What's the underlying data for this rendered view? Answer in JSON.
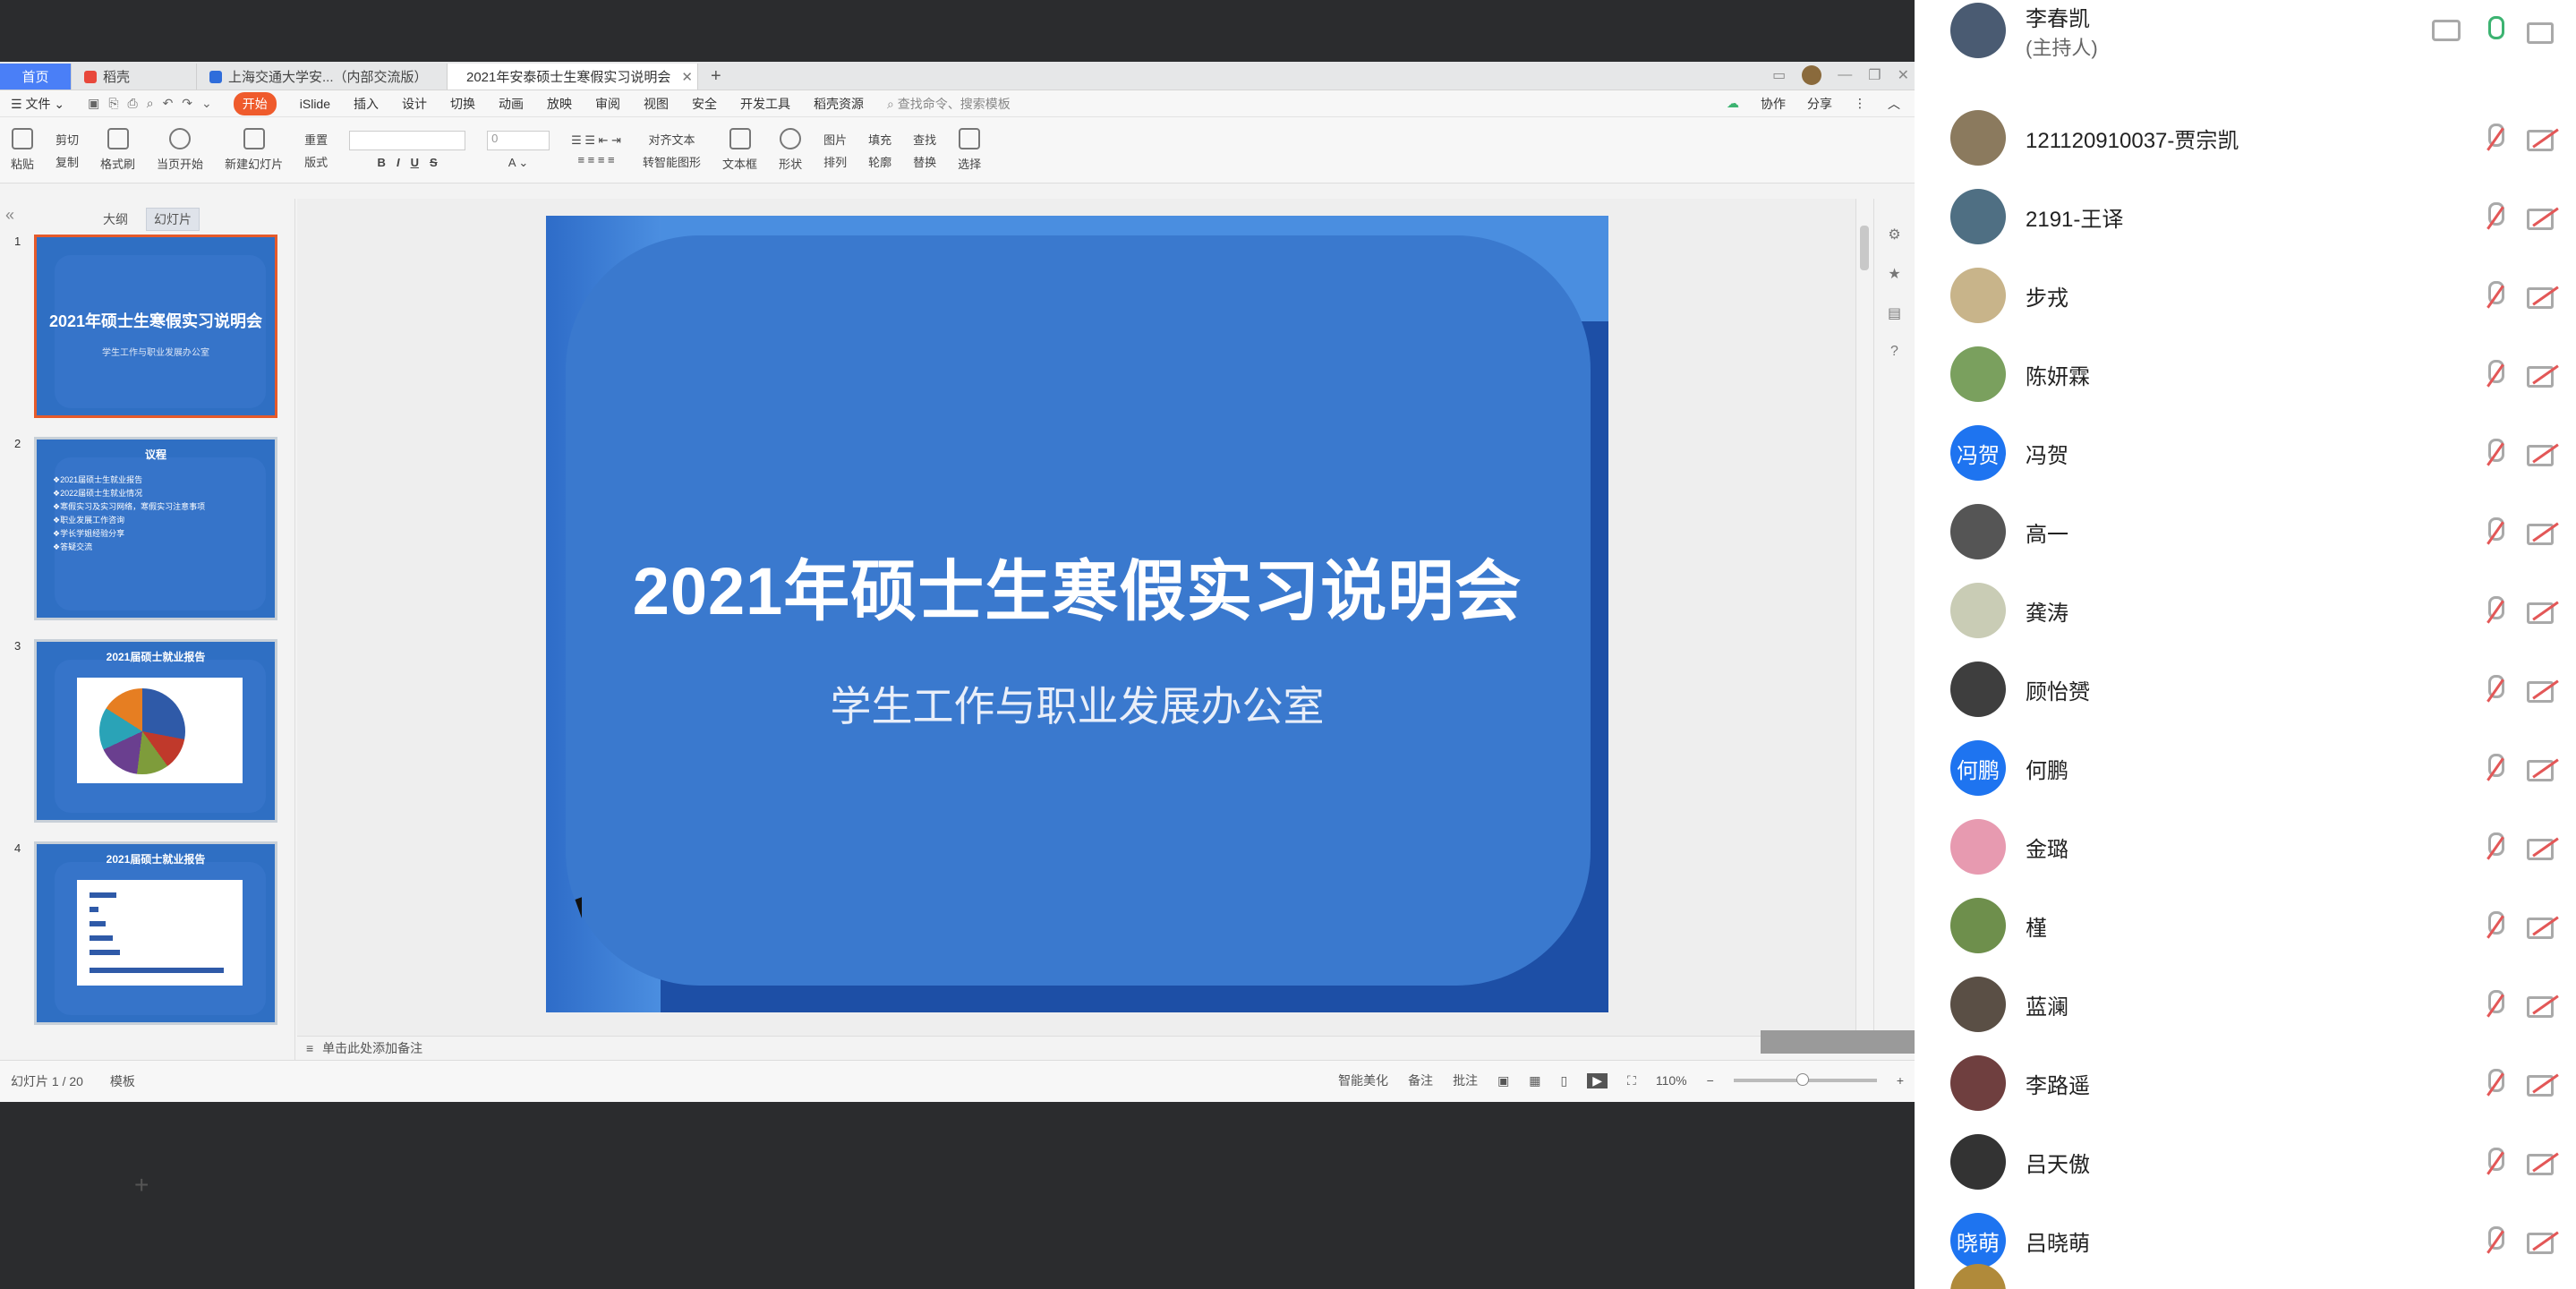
{
  "wps": {
    "tabs": [
      {
        "label": "首页"
      },
      {
        "label": "稻壳"
      },
      {
        "label": "上海交通大学安...（内部交流版）"
      },
      {
        "label": "2021年安泰硕士生寒假实习说明会"
      }
    ],
    "menu": [
      "文件",
      "开始",
      "iSlide",
      "插入",
      "设计",
      "切换",
      "动画",
      "放映",
      "审阅",
      "视图",
      "安全",
      "开发工具",
      "稻壳资源"
    ],
    "search_placeholder": "查找命令、搜索模板",
    "collab": "协作",
    "share": "分享",
    "ribbon": {
      "paste": "粘贴",
      "cut": "剪切",
      "copy": "复制",
      "format_painter": "格式刷",
      "from_current": "当页开始",
      "new_slide": "新建幻灯片",
      "layout": "版式",
      "reset": "重置",
      "font_size": "0",
      "align_text": "对齐文本",
      "smart_shape": "转智能图形",
      "textbox": "文本框",
      "shape": "形状",
      "picture": "图片",
      "arrange": "排列",
      "fill": "填充",
      "outline": "轮廓",
      "find": "查找",
      "replace": "替换",
      "select": "选择"
    },
    "left_tabs": {
      "outline": "大纲",
      "slides": "幻灯片"
    },
    "thumbs": [
      {
        "num": "1",
        "title": "2021年硕士生寒假实习说明会",
        "sub": "学生工作与职业发展办公室"
      },
      {
        "num": "2",
        "title": "议程",
        "items": [
          "2021届硕士生就业报告",
          "2022届硕士生就业情况",
          "寒假实习及实习网络，寒假实习注意事项",
          "职业发展工作咨询",
          "学长学姐经验分享",
          "答疑交流"
        ]
      },
      {
        "num": "3",
        "title": "2021届硕士就业报告"
      },
      {
        "num": "4",
        "title": "2021届硕士就业报告"
      }
    ],
    "slide": {
      "title": "2021年硕士生寒假实习说明会",
      "subtitle": "学生工作与职业发展办公室"
    },
    "notes_placeholder": "单击此处添加备注",
    "status": {
      "slide_count": "幻灯片 1 / 20",
      "template": "模板",
      "beautify": "智能美化",
      "notes": "备注",
      "comments": "批注",
      "zoom": "110%"
    }
  },
  "participants": [
    {
      "name": "李春凯",
      "role": "(主持人)",
      "avatar_color": "#4a5b72",
      "host": true
    },
    {
      "name": "121120910037-贾宗凯",
      "avatar_color": "#8b7a5e"
    },
    {
      "name": "2191-王译",
      "avatar_color": "#4f6f83"
    },
    {
      "name": "步戎",
      "avatar_color": "#c8b48a"
    },
    {
      "name": "陈妍霖",
      "avatar_color": "#7aa05e"
    },
    {
      "name": "冯贺",
      "avatar_color": "#1e74f0",
      "initials": "冯贺"
    },
    {
      "name": "高一",
      "avatar_color": "#555555"
    },
    {
      "name": "龚涛",
      "avatar_color": "#c9ccb5"
    },
    {
      "name": "顾怡赟",
      "avatar_color": "#3e3e3e"
    },
    {
      "name": "何鹏",
      "avatar_color": "#1e74f0",
      "initials": "何鹏"
    },
    {
      "name": "金璐",
      "avatar_color": "#e79ab0"
    },
    {
      "name": "槿",
      "avatar_color": "#6e8f4c"
    },
    {
      "name": "蓝澜",
      "avatar_color": "#5a4f45"
    },
    {
      "name": "李路遥",
      "avatar_color": "#6f3f3f"
    },
    {
      "name": "吕天傲",
      "avatar_color": "#333333"
    },
    {
      "name": "吕晓萌",
      "avatar_color": "#1e74f0",
      "initials": "晓萌"
    }
  ]
}
